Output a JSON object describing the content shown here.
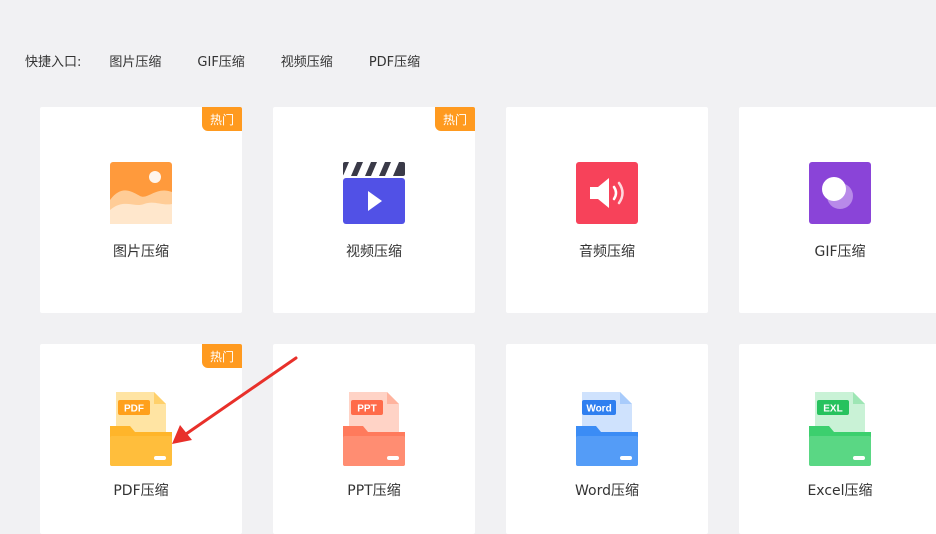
{
  "quick_access": {
    "label": "快捷入口:",
    "links": [
      "图片压缩",
      "GIF压缩",
      "视频压缩",
      "PDF压缩"
    ]
  },
  "badge_hot": "热门",
  "tools": [
    {
      "label": "图片压缩",
      "icon": "image-icon",
      "color": "#ff9a3c",
      "hot": true
    },
    {
      "label": "视频压缩",
      "icon": "video-clapper-icon",
      "color": "#5151e6",
      "hot": true
    },
    {
      "label": "音频压缩",
      "icon": "speaker-icon",
      "color": "#f7425a",
      "hot": false
    },
    {
      "label": "GIF压缩",
      "icon": "gif-circle-icon",
      "color": "#8a44d8",
      "hot": false
    },
    {
      "label": "PDF压缩",
      "icon": "pdf-folder-icon",
      "tag": "PDF",
      "color": "#ffb52a",
      "hot": true
    },
    {
      "label": "PPT压缩",
      "icon": "ppt-folder-icon",
      "tag": "PPT",
      "color": "#ff7a5c",
      "hot": false
    },
    {
      "label": "Word压缩",
      "icon": "word-folder-icon",
      "tag": "Word",
      "color": "#3b8cf5",
      "hot": false
    },
    {
      "label": "Excel压缩",
      "icon": "excel-folder-icon",
      "tag": "EXL",
      "color": "#3ccf6e",
      "hot": false
    }
  ],
  "annotation": {
    "icon": "red-arrow-icon",
    "color": "#e8302a"
  }
}
